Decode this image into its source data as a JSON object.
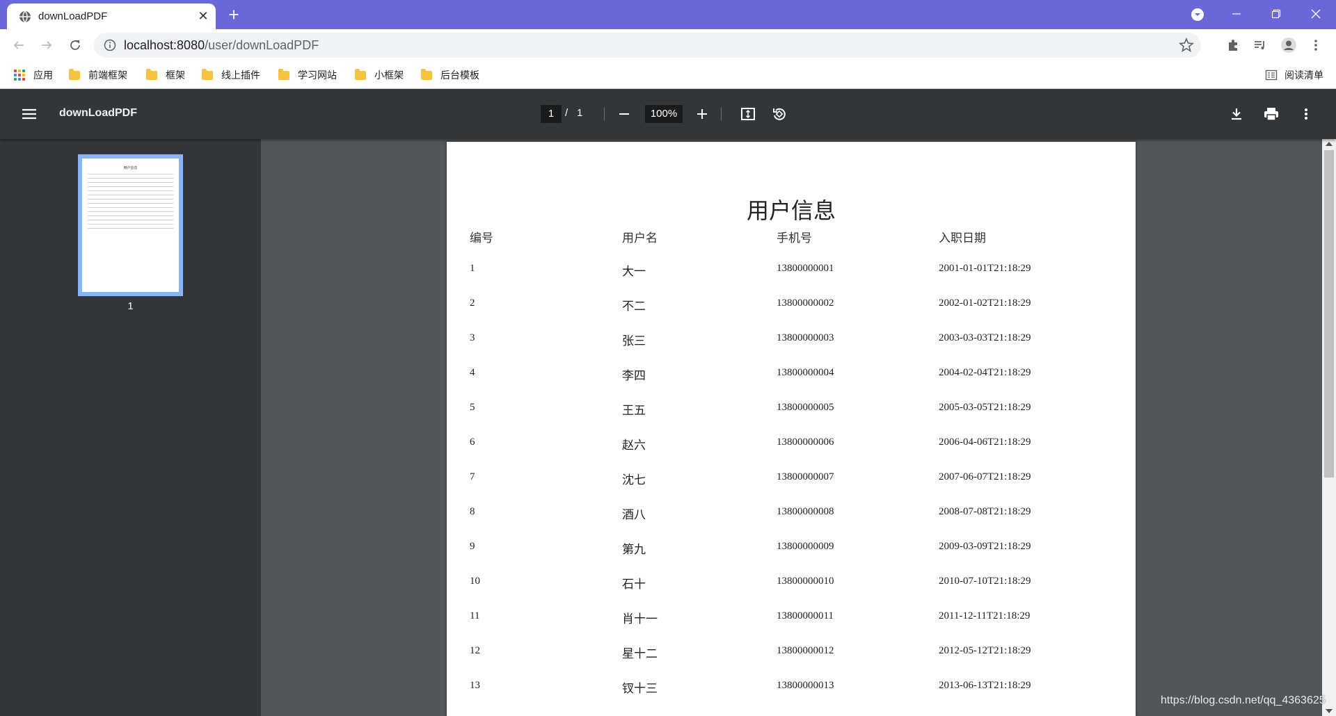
{
  "browser": {
    "tab_title": "downLoadPDF",
    "new_tab": "+",
    "url_host": "localhost:8080",
    "url_path": "/user/downLoadPDF",
    "accent_color": "#6a67d6"
  },
  "bookmarks": {
    "apps_label": "应用",
    "items": [
      "前端框架",
      "框架",
      "线上插件",
      "学习网站",
      "小框架",
      "后台模板"
    ],
    "reading_list": "阅读清单"
  },
  "pdf_viewer": {
    "title": "downLoadPDF",
    "page_current": "1",
    "page_sep": "/",
    "page_total": "1",
    "zoom": "100%",
    "thumbnail_label": "1"
  },
  "document": {
    "title": "用户信息",
    "columns": [
      "编号",
      "用户名",
      "手机号",
      "入职日期"
    ],
    "rows": [
      [
        "1",
        "大一",
        "13800000001",
        "2001-01-01T21:18:29"
      ],
      [
        "2",
        "不二",
        "13800000002",
        "2002-01-02T21:18:29"
      ],
      [
        "3",
        "张三",
        "13800000003",
        "2003-03-03T21:18:29"
      ],
      [
        "4",
        "李四",
        "13800000004",
        "2004-02-04T21:18:29"
      ],
      [
        "5",
        "王五",
        "13800000005",
        "2005-03-05T21:18:29"
      ],
      [
        "6",
        "赵六",
        "13800000006",
        "2006-04-06T21:18:29"
      ],
      [
        "7",
        "沈七",
        "13800000007",
        "2007-06-07T21:18:29"
      ],
      [
        "8",
        "酒八",
        "13800000008",
        "2008-07-08T21:18:29"
      ],
      [
        "9",
        "第九",
        "13800000009",
        "2009-03-09T21:18:29"
      ],
      [
        "10",
        "石十",
        "13800000010",
        "2010-07-10T21:18:29"
      ],
      [
        "11",
        "肖十一",
        "13800000011",
        "2011-12-11T21:18:29"
      ],
      [
        "12",
        "星十二",
        "13800000012",
        "2012-05-12T21:18:29"
      ],
      [
        "13",
        "钗十三",
        "13800000013",
        "2013-06-13T21:18:29"
      ]
    ]
  },
  "watermark": "https://blog.csdn.net/qq_4363625"
}
